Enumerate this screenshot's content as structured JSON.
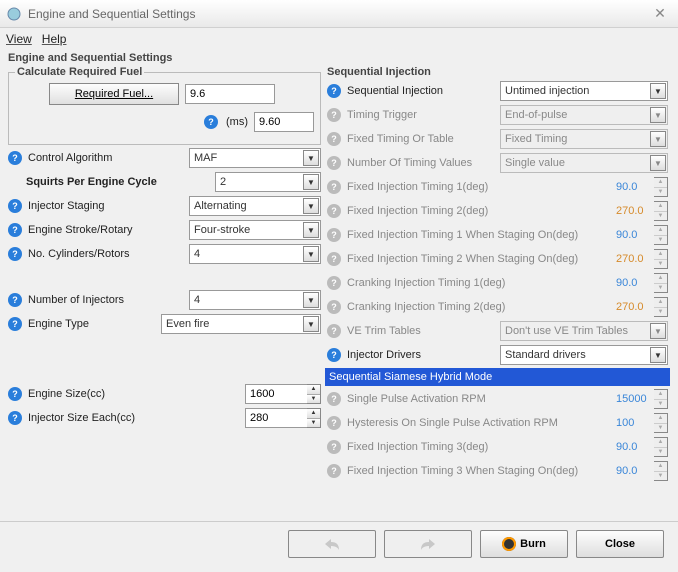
{
  "window": {
    "title": "Engine and Sequential Settings"
  },
  "menu": {
    "view": "View",
    "help": "Help"
  },
  "section_label": "Engine and Sequential Settings",
  "calc": {
    "legend": "Calculate Required Fuel",
    "btn": "Required Fuel...",
    "val1": "9.6",
    "ms_label": "(ms)",
    "val2": "9.60"
  },
  "left": {
    "control_alg": {
      "label": "Control Algorithm",
      "value": "MAF"
    },
    "squirts": {
      "label": "Squirts Per Engine Cycle",
      "value": "2"
    },
    "inj_staging": {
      "label": "Injector Staging",
      "value": "Alternating"
    },
    "stroke": {
      "label": "Engine Stroke/Rotary",
      "value": "Four-stroke"
    },
    "cylinders": {
      "label": "No. Cylinders/Rotors",
      "value": "4"
    },
    "num_inj": {
      "label": "Number of Injectors",
      "value": "4"
    },
    "eng_type": {
      "label": "Engine Type",
      "value": "Even fire"
    },
    "eng_size": {
      "label": "Engine Size(cc)",
      "value": "1600"
    },
    "inj_size": {
      "label": "Injector Size Each(cc)",
      "value": "280"
    }
  },
  "seq": {
    "legend": "Sequential Injection",
    "seq_inj": {
      "label": "Sequential Injection",
      "value": "Untimed injection"
    },
    "timing_trigger": {
      "label": "Timing Trigger",
      "value": "End-of-pulse"
    },
    "fixed_or_table": {
      "label": "Fixed Timing Or Table",
      "value": "Fixed Timing"
    },
    "num_timing": {
      "label": "Number Of Timing Values",
      "value": "Single value"
    },
    "fit1": {
      "label": "Fixed Injection Timing 1(deg)",
      "value": "90.0"
    },
    "fit2": {
      "label": "Fixed Injection Timing 2(deg)",
      "value": "270.0"
    },
    "fit1s": {
      "label": "Fixed Injection Timing 1 When Staging On(deg)",
      "value": "90.0"
    },
    "fit2s": {
      "label": "Fixed Injection Timing 2 When Staging On(deg)",
      "value": "270.0"
    },
    "crank1": {
      "label": "Cranking Injection Timing 1(deg)",
      "value": "90.0"
    },
    "crank2": {
      "label": "Cranking Injection Timing 2(deg)",
      "value": "270.0"
    },
    "ve_trim": {
      "label": "VE Trim Tables",
      "value": "Don't use VE Trim Tables"
    },
    "inj_drivers": {
      "label": "Injector Drivers",
      "value": "Standard drivers"
    },
    "hybrid": "Sequential Siamese Hybrid Mode",
    "spa_rpm": {
      "label": "Single Pulse Activation RPM",
      "value": "15000"
    },
    "hyst": {
      "label": "Hysteresis On Single Pulse Activation RPM",
      "value": "100"
    },
    "fit3": {
      "label": "Fixed Injection Timing 3(deg)",
      "value": "90.0"
    },
    "fit3s": {
      "label": "Fixed Injection Timing 3 When Staging On(deg)",
      "value": "90.0"
    }
  },
  "footer": {
    "burn": "Burn",
    "close": "Close"
  }
}
